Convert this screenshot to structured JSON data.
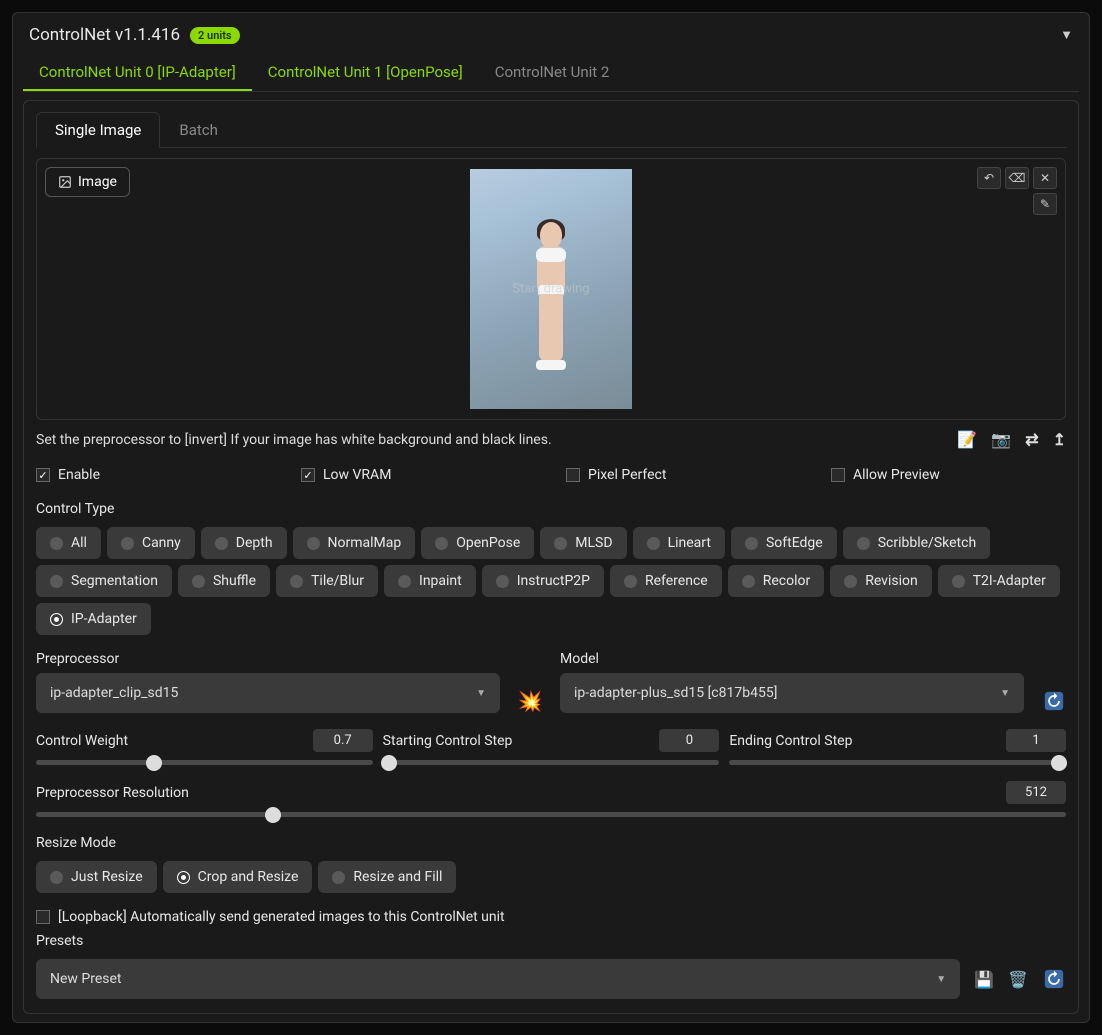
{
  "header": {
    "title": "ControlNet v1.1.416",
    "badge": "2 units"
  },
  "tabs": [
    {
      "label": "ControlNet Unit 0 [IP-Adapter]",
      "active": true,
      "configured": true
    },
    {
      "label": "ControlNet Unit 1 [OpenPose]",
      "active": false,
      "configured": true
    },
    {
      "label": "ControlNet Unit 2",
      "active": false,
      "configured": false
    }
  ],
  "subTabs": [
    {
      "label": "Single Image",
      "active": true
    },
    {
      "label": "Batch",
      "active": false
    }
  ],
  "imageArea": {
    "buttonLabel": "Image",
    "drawText": "Start drawing"
  },
  "hint": "Set the preprocessor to [invert] If your image has white background and black lines.",
  "checks": [
    {
      "label": "Enable",
      "checked": true
    },
    {
      "label": "Low VRAM",
      "checked": true
    },
    {
      "label": "Pixel Perfect",
      "checked": false
    },
    {
      "label": "Allow Preview",
      "checked": false
    }
  ],
  "controlType": {
    "label": "Control Type",
    "options": [
      "All",
      "Canny",
      "Depth",
      "NormalMap",
      "OpenPose",
      "MLSD",
      "Lineart",
      "SoftEdge",
      "Scribble/Sketch",
      "Segmentation",
      "Shuffle",
      "Tile/Blur",
      "Inpaint",
      "InstructP2P",
      "Reference",
      "Recolor",
      "Revision",
      "T2I-Adapter",
      "IP-Adapter"
    ],
    "selected": "IP-Adapter"
  },
  "preprocessor": {
    "label": "Preprocessor",
    "value": "ip-adapter_clip_sd15"
  },
  "model": {
    "label": "Model",
    "value": "ip-adapter-plus_sd15 [c817b455]"
  },
  "sliders": {
    "controlWeight": {
      "label": "Control Weight",
      "value": "0.7",
      "pct": 35
    },
    "startStep": {
      "label": "Starting Control Step",
      "value": "0",
      "pct": 0
    },
    "endStep": {
      "label": "Ending Control Step",
      "value": "1",
      "pct": 100
    },
    "resolution": {
      "label": "Preprocessor Resolution",
      "value": "512",
      "pct": 23
    }
  },
  "resizeMode": {
    "label": "Resize Mode",
    "options": [
      "Just Resize",
      "Crop and Resize",
      "Resize and Fill"
    ],
    "selected": "Crop and Resize"
  },
  "loopback": {
    "label": "[Loopback] Automatically send generated images to this ControlNet unit",
    "checked": false
  },
  "presets": {
    "label": "Presets",
    "value": "New Preset"
  }
}
